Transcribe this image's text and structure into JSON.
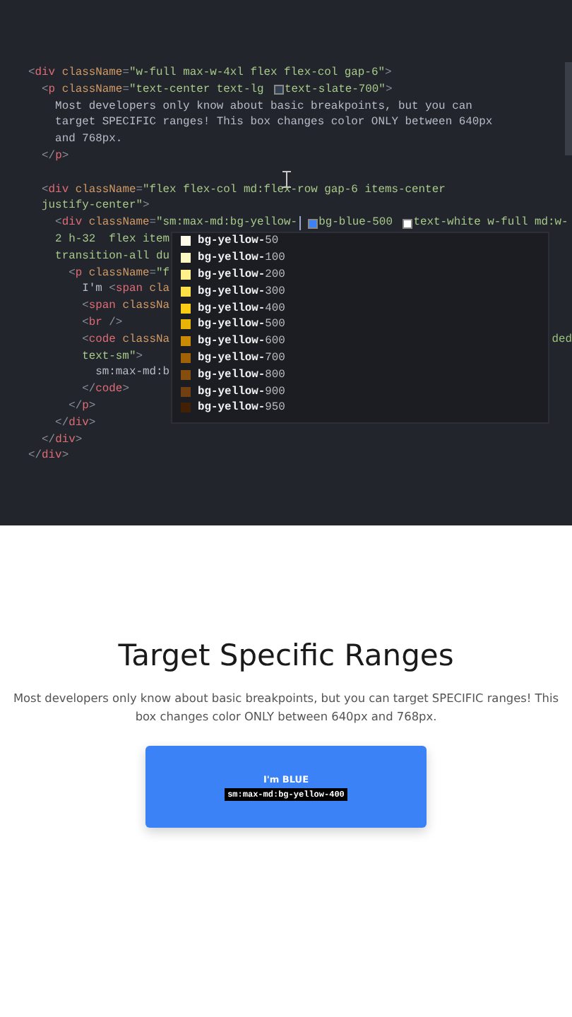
{
  "editor": {
    "lines": [
      {
        "kind": "code",
        "tokens": [
          {
            "kind": "punct",
            "t": "<"
          },
          {
            "kind": "tag",
            "t": "div"
          },
          {
            "kind": "attr",
            "t": " className"
          },
          {
            "kind": "punct",
            "t": "="
          },
          {
            "kind": "string",
            "t": "\"w-full max-w-4xl flex flex-col gap-6\""
          },
          {
            "kind": "punct",
            "t": ">"
          }
        ]
      },
      {
        "kind": "code",
        "tokens": [
          {
            "kind": "punct",
            "t": "  <"
          },
          {
            "kind": "tag",
            "t": "p"
          },
          {
            "kind": "attr",
            "t": " className"
          },
          {
            "kind": "punct",
            "t": "="
          },
          {
            "kind": "string",
            "t": "\"text-center text-lg "
          },
          {
            "kind": "swatch",
            "color": "#334155"
          },
          {
            "kind": "string",
            "t": "text-slate-700\""
          },
          {
            "kind": "punct",
            "t": ">"
          }
        ]
      },
      {
        "kind": "code",
        "tokens": [
          {
            "kind": "text",
            "t": "    Most developers only know about basic breakpoints, but you can"
          }
        ]
      },
      {
        "kind": "code",
        "tokens": [
          {
            "kind": "text",
            "t": "    target SPECIFIC ranges! This box changes color ONLY between 640px"
          }
        ]
      },
      {
        "kind": "code",
        "tokens": [
          {
            "kind": "text",
            "t": "    and 768px."
          }
        ]
      },
      {
        "kind": "code",
        "tokens": [
          {
            "kind": "punct",
            "t": "  </"
          },
          {
            "kind": "tag",
            "t": "p"
          },
          {
            "kind": "punct",
            "t": ">"
          }
        ]
      },
      {
        "kind": "blank"
      },
      {
        "kind": "code",
        "tokens": [
          {
            "kind": "punct",
            "t": "  <"
          },
          {
            "kind": "tag",
            "t": "div"
          },
          {
            "kind": "attr",
            "t": " className"
          },
          {
            "kind": "punct",
            "t": "="
          },
          {
            "kind": "string",
            "t": "\"flex flex-col md:flex-row gap-6 items-center"
          }
        ]
      },
      {
        "kind": "code",
        "tokens": [
          {
            "kind": "string",
            "t": "  justify-center\""
          },
          {
            "kind": "punct",
            "t": ">"
          }
        ]
      },
      {
        "kind": "code",
        "tokens": [
          {
            "kind": "punct",
            "t": "    <"
          },
          {
            "kind": "tag",
            "t": "div"
          },
          {
            "kind": "attr",
            "t": " className"
          },
          {
            "kind": "punct",
            "t": "="
          },
          {
            "kind": "string",
            "t": "\"sm:max-md:bg-yellow-"
          },
          {
            "kind": "caret"
          },
          {
            "kind": "swatch",
            "color": "#3b82f6"
          },
          {
            "kind": "string",
            "t": "bg-blue-500 "
          },
          {
            "kind": "swatch",
            "color": "#ffffff"
          },
          {
            "kind": "string",
            "t": "text-white w-full md:w-"
          }
        ]
      },
      {
        "kind": "code",
        "tokens": [
          {
            "kind": "string",
            "t": "    2 h-32  flex item"
          }
        ]
      },
      {
        "kind": "code",
        "tokens": [
          {
            "kind": "string",
            "t": "    transition-all du"
          }
        ]
      },
      {
        "kind": "code",
        "tokens": [
          {
            "kind": "punct",
            "t": "      <"
          },
          {
            "kind": "tag",
            "t": "p"
          },
          {
            "kind": "attr",
            "t": " className"
          },
          {
            "kind": "punct",
            "t": "="
          },
          {
            "kind": "string",
            "t": "\"f"
          }
        ]
      },
      {
        "kind": "code",
        "tokens": [
          {
            "kind": "text",
            "t": "        I'm "
          },
          {
            "kind": "punct",
            "t": "<"
          },
          {
            "kind": "tag",
            "t": "span"
          },
          {
            "kind": "attr",
            "t": " cla"
          }
        ]
      },
      {
        "kind": "code",
        "tokens": [
          {
            "kind": "punct",
            "t": "        <"
          },
          {
            "kind": "tag",
            "t": "span"
          },
          {
            "kind": "attr",
            "t": " classNa"
          }
        ]
      },
      {
        "kind": "code",
        "tokens": [
          {
            "kind": "punct",
            "t": "        <"
          },
          {
            "kind": "tag",
            "t": "br"
          },
          {
            "kind": "punct",
            "t": " />"
          }
        ]
      },
      {
        "kind": "code",
        "tokens": [
          {
            "kind": "punct",
            "t": "        <"
          },
          {
            "kind": "tag",
            "t": "code"
          },
          {
            "kind": "attr",
            "t": " classNa"
          }
        ],
        "tail": "ded"
      },
      {
        "kind": "code",
        "tokens": [
          {
            "kind": "string",
            "t": "        text-sm\""
          },
          {
            "kind": "punct",
            "t": ">"
          }
        ]
      },
      {
        "kind": "code",
        "tokens": [
          {
            "kind": "text",
            "t": "          sm:max-md:b"
          }
        ]
      },
      {
        "kind": "code",
        "tokens": [
          {
            "kind": "punct",
            "t": "        </"
          },
          {
            "kind": "tag",
            "t": "code"
          },
          {
            "kind": "punct",
            "t": ">"
          }
        ]
      },
      {
        "kind": "code",
        "tokens": [
          {
            "kind": "punct",
            "t": "      </"
          },
          {
            "kind": "tag",
            "t": "p"
          },
          {
            "kind": "punct",
            "t": ">"
          }
        ]
      },
      {
        "kind": "code",
        "tokens": [
          {
            "kind": "punct",
            "t": "    </"
          },
          {
            "kind": "tag",
            "t": "div"
          },
          {
            "kind": "punct",
            "t": ">"
          }
        ]
      },
      {
        "kind": "code",
        "tokens": [
          {
            "kind": "punct",
            "t": "  </"
          },
          {
            "kind": "tag",
            "t": "div"
          },
          {
            "kind": "punct",
            "t": ">"
          }
        ]
      },
      {
        "kind": "code",
        "tokens": [
          {
            "kind": "punct",
            "t": "</"
          },
          {
            "kind": "tag",
            "t": "div"
          },
          {
            "kind": "punct",
            "t": ">"
          }
        ]
      }
    ],
    "suggestions": [
      {
        "label": "**bg-yellow-**50",
        "color": "#fefce8",
        "selected": false
      },
      {
        "label": "**bg-yellow-**100",
        "color": "#fef9c3",
        "selected": false
      },
      {
        "label": "**bg-yellow-**200",
        "color": "#fef08a",
        "selected": false
      },
      {
        "label": "**bg-yellow-**300",
        "color": "#fde047",
        "selected": false
      },
      {
        "label": "**bg-yellow-**400",
        "color": "#facc15",
        "selected": false
      },
      {
        "label": "**bg-yellow-**500",
        "color": "#eab308",
        "selected": false
      },
      {
        "label": "**bg-yellow-**600",
        "color": "#ca8a04",
        "selected": false
      },
      {
        "label": "**bg-yellow-**700",
        "color": "#a16207",
        "selected": false
      },
      {
        "label": "**bg-yellow-**800",
        "color": "#854d0e",
        "selected": false
      },
      {
        "label": "**bg-yellow-**900",
        "color": "#713f12",
        "selected": false
      },
      {
        "label": "**bg-yellow-**950",
        "color": "#422006",
        "selected": false
      }
    ]
  },
  "preview": {
    "title": "Target Specific Ranges",
    "description": "Most developers only know about basic breakpoints, but you can target SPECIFIC ranges! This box changes color ONLY between 640px and 768px.",
    "box": {
      "label": "I'm BLUE",
      "code": "sm:max-md:bg-yellow-400"
    }
  }
}
